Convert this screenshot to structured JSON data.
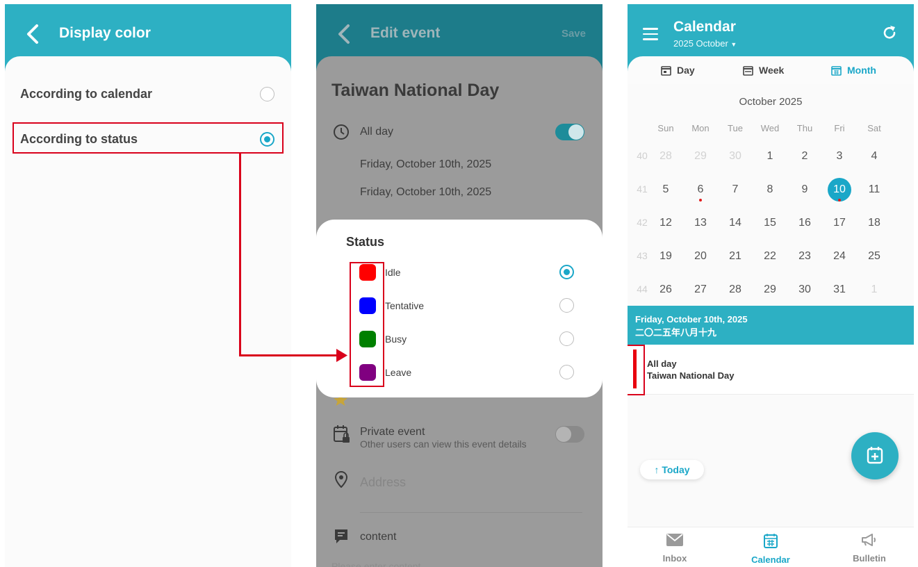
{
  "colors": {
    "accent": "#2db0c3",
    "highlight": "#d9001b",
    "selected": "#1aa7c8"
  },
  "display_color": {
    "title": "Display color",
    "options": [
      {
        "label": "According to calendar",
        "selected": false
      },
      {
        "label": "According to status",
        "selected": true
      }
    ]
  },
  "edit_event": {
    "title": "Edit event",
    "save_label": "Save",
    "event_title": "Taiwan National Day",
    "all_day_label": "All day",
    "all_day_on": true,
    "start_date": "Friday, October 10th, 2025",
    "end_date": "Friday, October 10th, 2025",
    "status_dialog": {
      "title": "Status",
      "options": [
        {
          "label": "Idle",
          "color": "#ff0000",
          "selected": true
        },
        {
          "label": "Tentative",
          "color": "#0000ff",
          "selected": false
        },
        {
          "label": "Busy",
          "color": "#008000",
          "selected": false
        },
        {
          "label": "Leave",
          "color": "#800080",
          "selected": false
        }
      ]
    },
    "private_label": "Private event",
    "private_desc": "Other users can view this event details",
    "private_on": false,
    "address_placeholder": "Address",
    "content_label": "content",
    "content_placeholder": "Please enter content"
  },
  "calendar": {
    "title": "Calendar",
    "subtitle": "2025 October",
    "tabs": [
      {
        "label": "Day",
        "icon": "calendar-day-icon",
        "active": false
      },
      {
        "label": "Week",
        "icon": "calendar-week-icon",
        "active": false
      },
      {
        "label": "Month",
        "icon": "calendar-month-icon",
        "active": true
      }
    ],
    "month_title": "October 2025",
    "weekdays": [
      "Sun",
      "Mon",
      "Tue",
      "Wed",
      "Thu",
      "Fri",
      "Sat"
    ],
    "weeks": [
      {
        "num": "40",
        "days": [
          {
            "d": "28",
            "muted": true
          },
          {
            "d": "29",
            "muted": true
          },
          {
            "d": "30",
            "muted": true
          },
          {
            "d": "1"
          },
          {
            "d": "2"
          },
          {
            "d": "3"
          },
          {
            "d": "4"
          }
        ]
      },
      {
        "num": "41",
        "days": [
          {
            "d": "5"
          },
          {
            "d": "6",
            "dot": true
          },
          {
            "d": "7"
          },
          {
            "d": "8"
          },
          {
            "d": "9"
          },
          {
            "d": "10",
            "selected": true,
            "dot": true
          },
          {
            "d": "11"
          }
        ]
      },
      {
        "num": "42",
        "days": [
          {
            "d": "12"
          },
          {
            "d": "13"
          },
          {
            "d": "14"
          },
          {
            "d": "15"
          },
          {
            "d": "16"
          },
          {
            "d": "17"
          },
          {
            "d": "18"
          }
        ]
      },
      {
        "num": "43",
        "days": [
          {
            "d": "19"
          },
          {
            "d": "20"
          },
          {
            "d": "21"
          },
          {
            "d": "22"
          },
          {
            "d": "23"
          },
          {
            "d": "24"
          },
          {
            "d": "25"
          }
        ]
      },
      {
        "num": "44",
        "days": [
          {
            "d": "26"
          },
          {
            "d": "27"
          },
          {
            "d": "28"
          },
          {
            "d": "29"
          },
          {
            "d": "30"
          },
          {
            "d": "31"
          },
          {
            "d": "1",
            "muted": true
          }
        ]
      }
    ],
    "selected_date": "Friday, October 10th, 2025",
    "lunar_date": "二〇二五年八月十九",
    "event": {
      "time": "All day",
      "title": "Taiwan National Day",
      "status_color": "#e8000e"
    },
    "today_label": "↑ Today",
    "nav": [
      {
        "label": "Inbox",
        "icon": "inbox-icon",
        "active": false
      },
      {
        "label": "Calendar",
        "icon": "calendar-icon",
        "active": true
      },
      {
        "label": "Bulletin",
        "icon": "megaphone-icon",
        "active": false
      }
    ]
  }
}
